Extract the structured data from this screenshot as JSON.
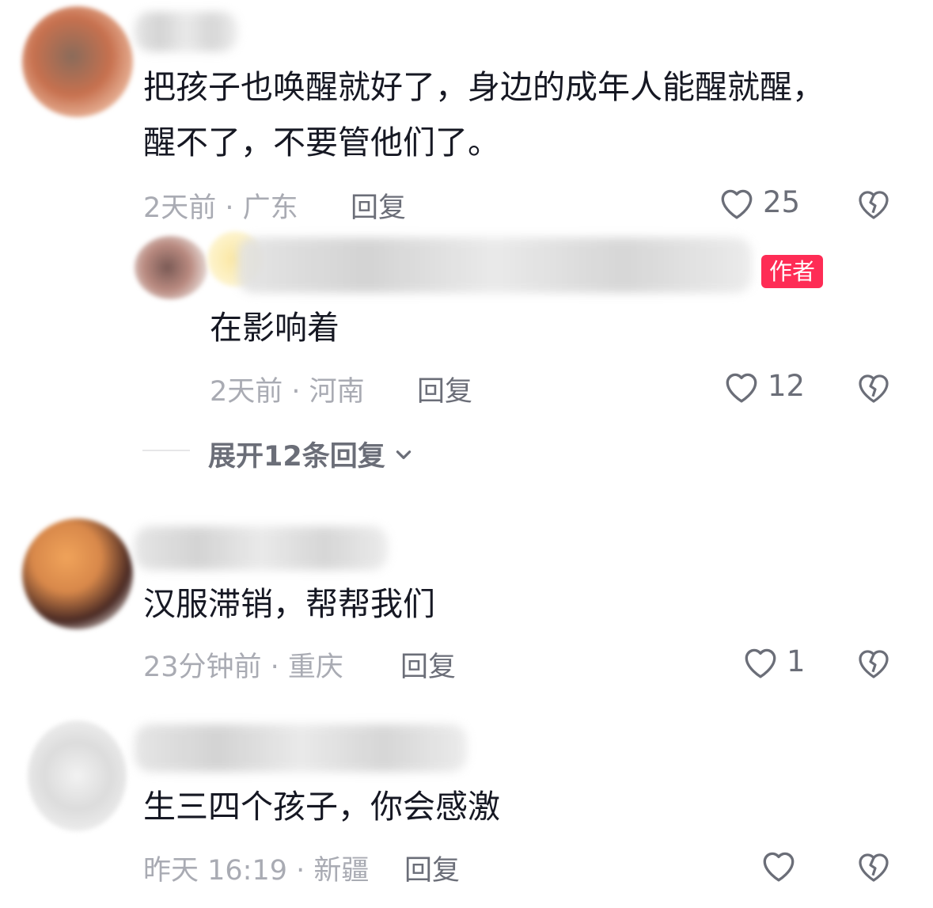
{
  "comments": [
    {
      "text_line1": "把孩子也唤醒就好了，身边的成年人能醒就醒，",
      "text_line2": "醒不了，不要管他们了。",
      "meta": "2天前 · 广东",
      "reply_label": "回复",
      "likes": "25"
    },
    {
      "badge": "作者",
      "text_line1": "在影响着",
      "meta": "2天前 · 河南",
      "reply_label": "回复",
      "likes": "12"
    },
    {
      "text_line1": "汉服滞销，帮帮我们",
      "meta": "23分钟前 · 重庆",
      "reply_label": "回复",
      "likes": "1"
    },
    {
      "text_line1": "生三四个孩子，你会感激",
      "meta": "昨天 16:19 · 新疆",
      "reply_label": "回复",
      "likes": ""
    }
  ],
  "expand_replies_label": "展开12条回复",
  "icons": {
    "like": "heart-outline-icon",
    "dislike": "broken-heart-icon",
    "expand": "chevron-down-icon"
  },
  "colors": {
    "badge": "#fe2c55",
    "meta": "#a9abb3",
    "secondary": "#6b6e78"
  }
}
